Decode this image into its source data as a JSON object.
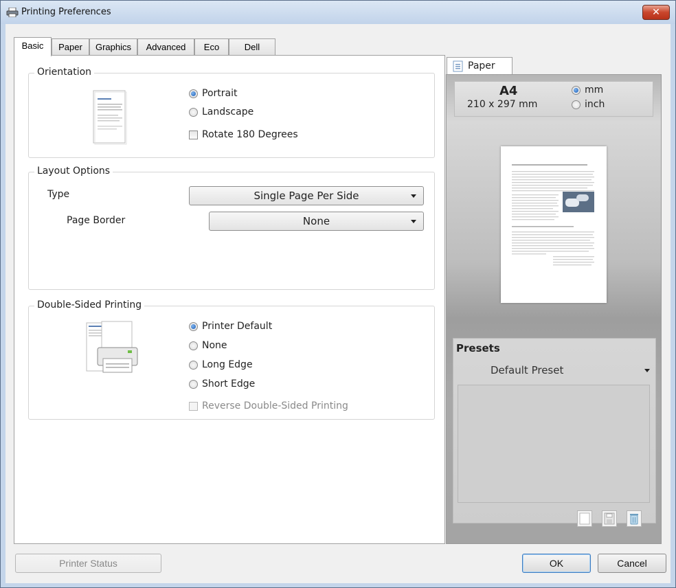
{
  "window": {
    "title": "Printing Preferences",
    "close_label": "✕"
  },
  "tabs": [
    {
      "label": "Basic"
    },
    {
      "label": "Paper"
    },
    {
      "label": "Graphics"
    },
    {
      "label": "Advanced"
    },
    {
      "label": "Eco"
    },
    {
      "label": "Dell"
    }
  ],
  "orientation": {
    "legend": "Orientation",
    "portrait": "Portrait",
    "landscape": "Landscape",
    "rotate": "Rotate 180 Degrees",
    "selected": "Portrait"
  },
  "layout_options": {
    "legend": "Layout Options",
    "type_label": "Type",
    "type_value": "Single Page Per Side",
    "border_label": "Page Border",
    "border_value": "None"
  },
  "double_sided": {
    "legend": "Double-Sided Printing",
    "options": [
      "Printer Default",
      "None",
      "Long Edge",
      "Short Edge"
    ],
    "selected": "Printer Default",
    "reverse": "Reverse Double-Sided Printing"
  },
  "preview": {
    "tab_label": "Paper",
    "paper_size": "A4",
    "paper_dims": "210 x 297 mm",
    "unit_mm": "mm",
    "unit_inch": "inch",
    "selected_unit": "mm"
  },
  "presets": {
    "title": "Presets",
    "selected": "Default Preset"
  },
  "buttons": {
    "printer_status": "Printer Status",
    "ok": "OK",
    "cancel": "Cancel"
  }
}
